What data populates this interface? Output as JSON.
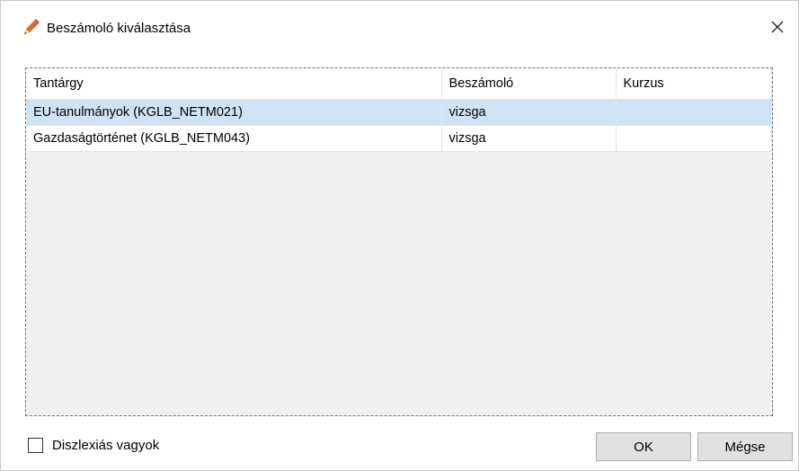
{
  "dialog": {
    "title": "Beszámoló kiválasztása",
    "close_glyph": "✕",
    "icon": "pencil-icon"
  },
  "table": {
    "columns": [
      "Tantárgy",
      "Beszámoló",
      "Kurzus"
    ],
    "rows": [
      {
        "subject": "EU-tanulmányok  (KGLB_NETM021)",
        "assessment": "vizsga",
        "course": "",
        "selected": true
      },
      {
        "subject": "Gazdaságtörténet (KGLB_NETM043)",
        "assessment": "vizsga",
        "course": "",
        "selected": false
      }
    ]
  },
  "footer": {
    "checkbox_label": "Diszlexiás vagyok",
    "checkbox_checked": false,
    "ok_label": "OK",
    "cancel_label": "Mégse"
  },
  "colors": {
    "selected_row": "#cfe3f7",
    "button_bg": "#e1e1e1"
  }
}
